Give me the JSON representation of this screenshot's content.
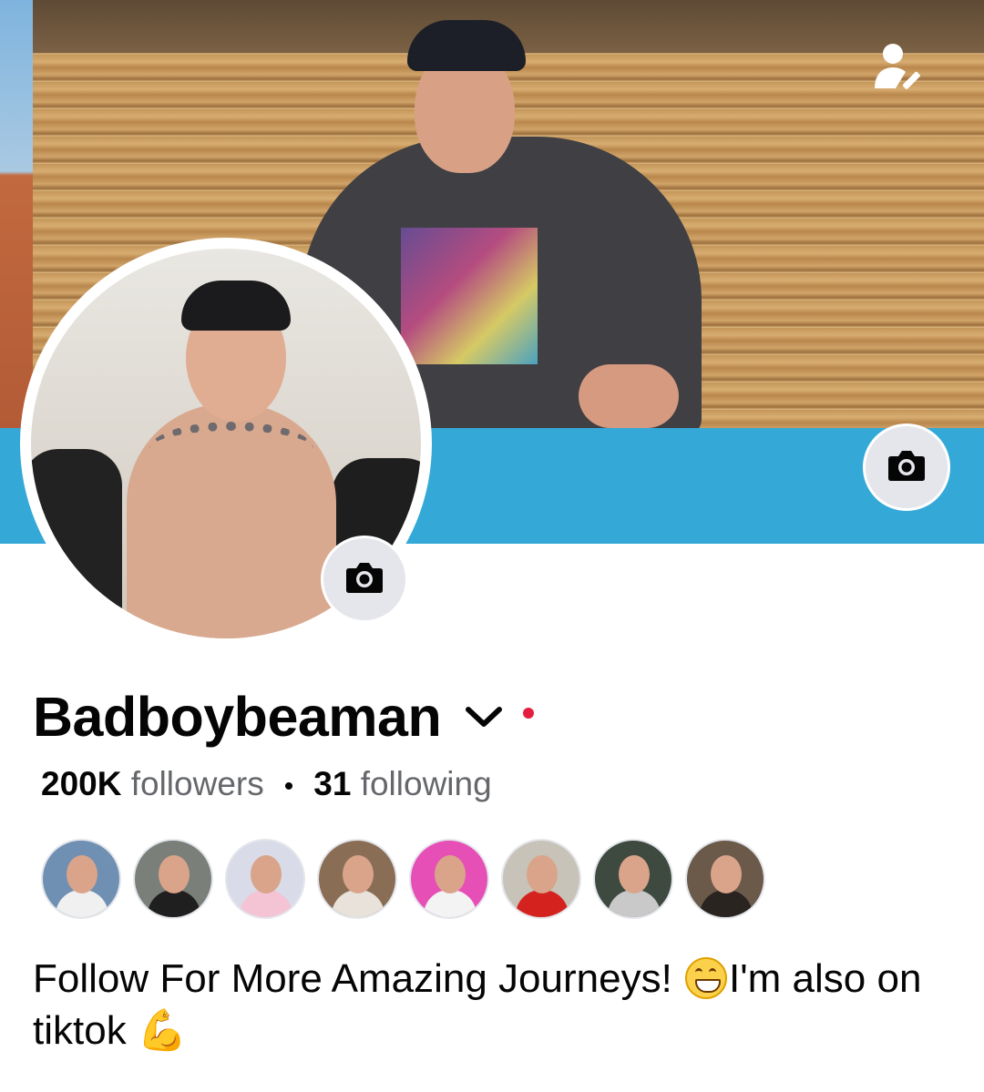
{
  "profile": {
    "name": "Badboybeaman",
    "followers_count": "200K",
    "followers_label": "followers",
    "following_count": "31",
    "following_label": "following",
    "bio_text": "Follow For More Amazing Journeys! ",
    "bio_emoji_1": "grinning-face-emoji",
    "bio_text_2": "I'm also on tiktok ",
    "bio_emoji_2": "💪"
  },
  "icons": {
    "profile_edit": "person-edit-icon",
    "cover_camera": "camera-icon",
    "avatar_camera": "camera-icon",
    "name_dropdown": "chevron-down-icon"
  },
  "colors": {
    "cover_accent": "#34a9d8",
    "notification_dot": "#e41e3f",
    "text_primary": "#050505",
    "text_secondary": "#65676b",
    "icon_button_bg": "#e4e6eb"
  },
  "follower_avatars": [
    {
      "bg": "#6f8fb3",
      "body": "#f0f0f0"
    },
    {
      "bg": "#7a7f7a",
      "body": "#1f1f1f"
    },
    {
      "bg": "#d9dce8",
      "body": "#f4c3d4"
    },
    {
      "bg": "#8a6d55",
      "body": "#e8e2da"
    },
    {
      "bg": "#e64fb6",
      "body": "#f3f3f3"
    },
    {
      "bg": "#c8c3b8",
      "body": "#d4231f"
    },
    {
      "bg": "#3e4a3f",
      "body": "#c9c9c9"
    },
    {
      "bg": "#6b5a4a",
      "body": "#2a2420"
    }
  ]
}
